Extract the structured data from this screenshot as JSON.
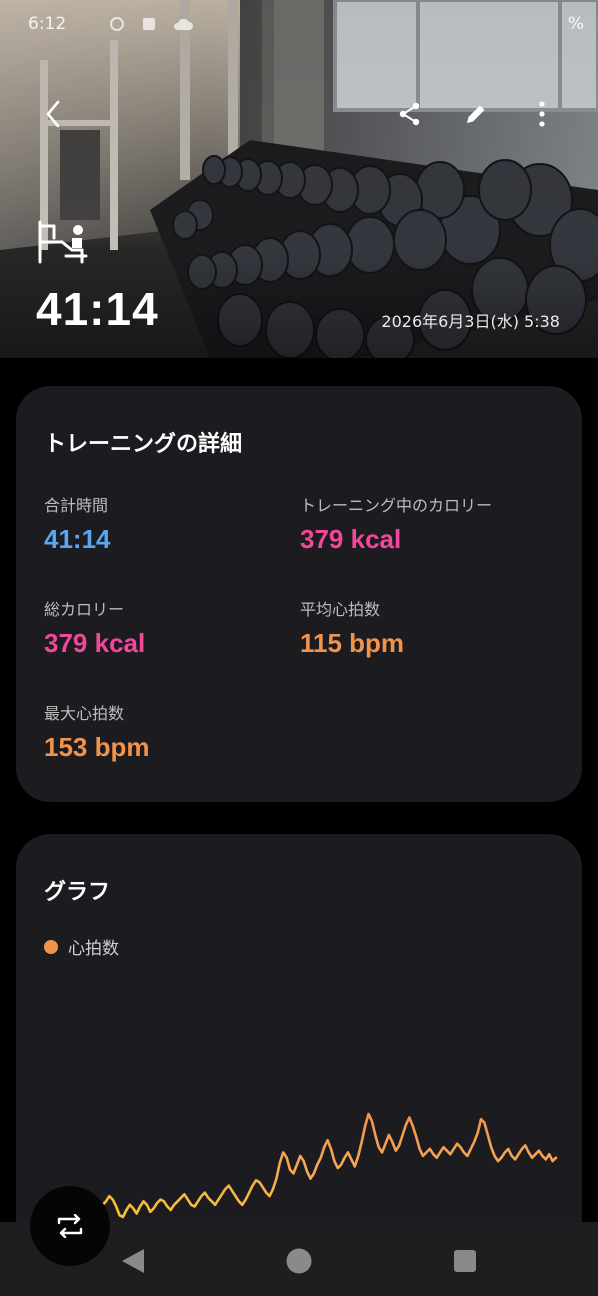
{
  "status_bar": {
    "time": "6:12",
    "battery": "%"
  },
  "header": {
    "icons": {
      "back": "chevron-left-icon",
      "share": "share-icon",
      "edit": "pencil-icon",
      "more": "more-vertical-icon"
    },
    "workout_icon": "weight-machine-icon",
    "duration": "41:14",
    "datetime": "2026年6月3日(水) 5:38"
  },
  "details": {
    "title": "トレーニングの詳細",
    "stats": [
      {
        "label": "合計時間",
        "value": "41:14",
        "color": "#5aa6f5"
      },
      {
        "label": "トレーニング中のカロリー",
        "value": "379 kcal",
        "color": "#f2479a"
      },
      {
        "label": "総カロリー",
        "value": "379 kcal",
        "color": "#f2479a"
      },
      {
        "label": "平均心拍数",
        "value": "115 bpm",
        "color": "#f2934c"
      },
      {
        "label": "最大心拍数",
        "value": "153 bpm",
        "color": "#f2934c"
      }
    ]
  },
  "graph": {
    "title": "グラフ",
    "legend": [
      {
        "label": "心拍数",
        "color": "#f2934c"
      }
    ]
  },
  "chart_data": {
    "type": "line",
    "title": "",
    "xlabel": "",
    "ylabel": "",
    "series": [
      {
        "name": "心拍数",
        "values": [
          98,
          102,
          99,
          101,
          95,
          92,
          96,
          100,
          97,
          103,
          104,
          99,
          96,
          91,
          94,
          99,
          101,
          103,
          106,
          104,
          100,
          95,
          94,
          98,
          101,
          99,
          96,
          100,
          103,
          101,
          97,
          99,
          102,
          104,
          103,
          100,
          98,
          101,
          103,
          105,
          107,
          104,
          101,
          100,
          103,
          106,
          108,
          105,
          103,
          101,
          104,
          107,
          110,
          112,
          109,
          106,
          103,
          101,
          104,
          108,
          112,
          115,
          114,
          111,
          108,
          106,
          110,
          116,
          125,
          131,
          128,
          121,
          119,
          124,
          129,
          126,
          120,
          116,
          119,
          124,
          128,
          134,
          138,
          133,
          126,
          122,
          124,
          128,
          131,
          127,
          123,
          129,
          137,
          146,
          153,
          149,
          141,
          134,
          131,
          136,
          141,
          137,
          132,
          135,
          141,
          147,
          151,
          146,
          140,
          133,
          129,
          131,
          133,
          130,
          128,
          131,
          134,
          132,
          130,
          133,
          136,
          134,
          131,
          129,
          133,
          137,
          142,
          150,
          148,
          141,
          134,
          129,
          126,
          128,
          131,
          133,
          129,
          127,
          130,
          133,
          135,
          131,
          128,
          130,
          132,
          129,
          127,
          130,
          126,
          128
        ]
      }
    ],
    "grid": false,
    "legend_position": "top-left"
  },
  "fab": {
    "icon": "switch-view-icon"
  },
  "nav": {
    "back": "nav-back-icon",
    "home": "nav-home-icon",
    "recents": "nav-recents-icon"
  }
}
